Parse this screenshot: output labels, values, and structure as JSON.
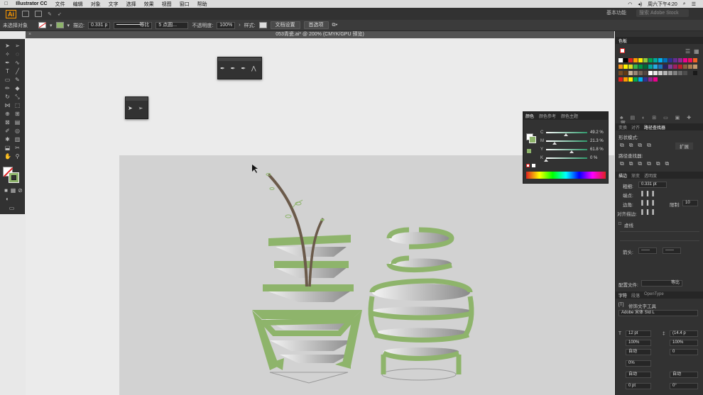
{
  "menubar": {
    "apple": "",
    "app": "Illustrator CC",
    "items": [
      "文件",
      "编辑",
      "对象",
      "文字",
      "选择",
      "效果",
      "视图",
      "窗口",
      "帮助"
    ],
    "clock": "周六下午4:20"
  },
  "appbar": {
    "logo": "Ai",
    "workspace": "基本功能",
    "search_placeholder": "搜索 Adobe Stock"
  },
  "controlbar": {
    "selection": "未选择对象",
    "stroke_label": "描边:",
    "stroke_value": "0.331 p",
    "stroke_type": "等比",
    "brush": "5 点圆...",
    "opacity_label": "不透明度:",
    "opacity_value": "100%",
    "style_label": "样式:",
    "doc_setup": "文档设置",
    "prefs": "首选项"
  },
  "document": {
    "tab_title": "053青瓷.ai* @ 200% (CMYK/GPU 预览)"
  },
  "color_panel": {
    "tabs": [
      "颜色",
      "颜色参考",
      "颜色主题"
    ],
    "channels": [
      {
        "label": "C",
        "value": "49.2",
        "pct": 0.49
      },
      {
        "label": "M",
        "value": "21.3",
        "pct": 0.21
      },
      {
        "label": "Y",
        "value": "61.8",
        "pct": 0.62
      },
      {
        "label": "K",
        "value": "0",
        "pct": 0.0
      }
    ],
    "unit": "%"
  },
  "right_panel": {
    "swatches_tab": "色板",
    "transform_tabs": [
      "变换",
      "对齐",
      "路径查找器"
    ],
    "shape_modes": "形状模式:",
    "expand": "扩展",
    "pathfinder": "路径查找器:",
    "stroke_tabs": [
      "描边",
      "渐变",
      "透明度"
    ],
    "weight_label": "粗细:",
    "weight_value": "0.331 pt",
    "cap_label": "端点:",
    "corner_label": "边角:",
    "limit_label": "限制:",
    "limit_value": "10",
    "align_stroke": "对齐描边:",
    "dashed": "虚线",
    "arrow_label": "箭头:",
    "profile_label": "配置文件:",
    "profile_value": "等比",
    "char_tabs": [
      "字符",
      "段落",
      "OpenType"
    ],
    "touch_type": "修饰文字工具",
    "font": "Adobe 宋体 Std L",
    "size": "12 pt",
    "leading": "(14.4 p",
    "scale_h": "100%",
    "scale_v": "100%",
    "tracking_auto": "自动",
    "kern": "0",
    "baseline": "0%",
    "auto1": "自动",
    "auto2": "自动",
    "pt0": "0 pt",
    "deg0": "0°"
  },
  "colors": {
    "green": "#8eb46b",
    "brown": "#6b5a4a",
    "artboard": "#d2d2d2",
    "panel": "#323232"
  }
}
